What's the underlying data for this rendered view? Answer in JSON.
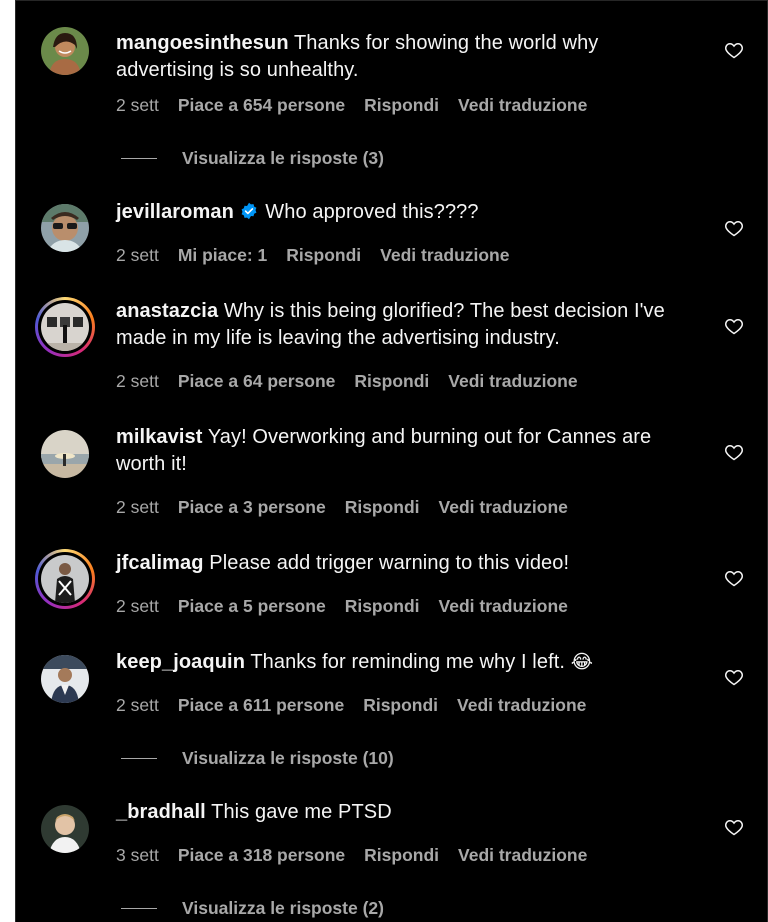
{
  "colors": {
    "background": "#000000",
    "text": "#f5f5f5",
    "meta": "#a8a8a8",
    "verified": "#0095f6"
  },
  "comments": [
    {
      "username": "mangoesinthesun",
      "text": "Thanks for showing the world why advertising is so unhealthy.",
      "time": "2 sett",
      "likes": "Piace a 654 persone",
      "reply": "Rispondi",
      "translate": "Vedi traduzione",
      "view_replies": "Visualizza le risposte (3)",
      "avatar_icon": "woman-portrait"
    },
    {
      "username": "jevillaroman",
      "verified": true,
      "text": "Who approved this????",
      "time": "2 sett",
      "likes": "Mi piace: 1",
      "reply": "Rispondi",
      "translate": "Vedi traduzione",
      "avatar_icon": "man-sunglasses"
    },
    {
      "username": "anastazcia",
      "text": "Why is this being glorified? The best decision I've made in my life is leaving the advertising industry.",
      "time": "2 sett",
      "likes": "Piace a 64 persone",
      "reply": "Rispondi",
      "translate": "Vedi traduzione",
      "avatar_icon": "gallery-story-ring"
    },
    {
      "username": "milkavist",
      "text": "Yay! Overworking and burning out for Cannes are worth it!",
      "time": "2 sett",
      "likes": "Piace a 3 persone",
      "reply": "Rispondi",
      "translate": "Vedi traduzione",
      "avatar_icon": "beach-sunset"
    },
    {
      "username": "jfcalimag",
      "text": "Please add trigger warning to this video!",
      "time": "2 sett",
      "likes": "Piace a 5 persone",
      "reply": "Rispondi",
      "translate": "Vedi traduzione",
      "avatar_icon": "person-story-ring"
    },
    {
      "username": "keep_joaquin",
      "text": "Thanks for reminding me why I left.",
      "emoji": "😂",
      "time": "2 sett",
      "likes": "Piace a 611 persone",
      "reply": "Rispondi",
      "translate": "Vedi traduzione",
      "view_replies": "Visualizza le risposte (10)",
      "avatar_icon": "man-portrait"
    },
    {
      "username": "_bradhall",
      "text": "This gave me PTSD",
      "time": "3 sett",
      "likes": "Piace a 318 persone",
      "reply": "Rispondi",
      "translate": "Vedi traduzione",
      "view_replies": "Visualizza le risposte (2)",
      "avatar_icon": "man-portrait-light"
    }
  ]
}
